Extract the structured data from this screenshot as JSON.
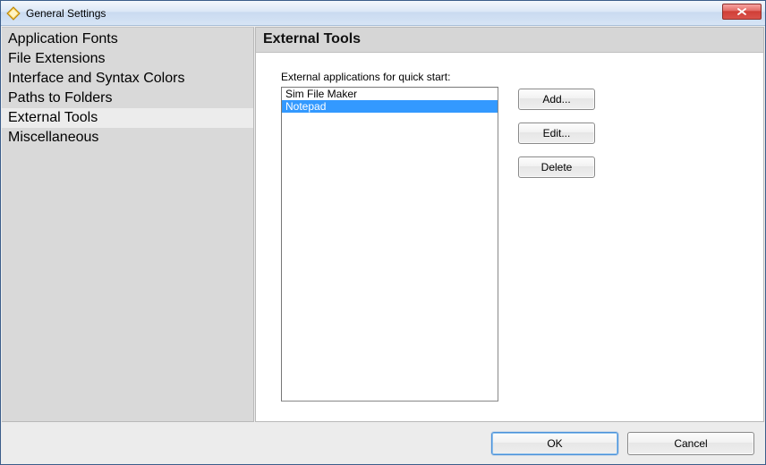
{
  "window": {
    "title": "General Settings"
  },
  "sidebar": {
    "items": [
      {
        "label": "Application Fonts",
        "selected": false
      },
      {
        "label": "File Extensions",
        "selected": false
      },
      {
        "label": "Interface and Syntax Colors",
        "selected": false
      },
      {
        "label": "Paths to Folders",
        "selected": false
      },
      {
        "label": "External Tools",
        "selected": true
      },
      {
        "label": "Miscellaneous",
        "selected": false
      }
    ]
  },
  "panel": {
    "title": "External Tools",
    "list_label": "External applications for quick start:",
    "items": [
      {
        "label": "Sim File Maker",
        "selected": false
      },
      {
        "label": "Notepad",
        "selected": true
      }
    ],
    "buttons": {
      "add": "Add...",
      "edit": "Edit...",
      "delete": "Delete"
    }
  },
  "footer": {
    "ok": "OK",
    "cancel": "Cancel"
  }
}
